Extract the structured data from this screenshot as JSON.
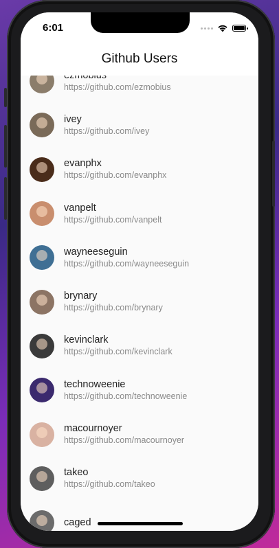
{
  "status_bar": {
    "time": "6:01"
  },
  "app_bar": {
    "title": "Github Users"
  },
  "users": [
    {
      "login": "ezmobius",
      "url": "https://github.com/ezmobius",
      "avatar_color": "#8b7d6b"
    },
    {
      "login": "ivey",
      "url": "https://github.com/ivey",
      "avatar_color": "#7a6a58"
    },
    {
      "login": "evanphx",
      "url": "https://github.com/evanphx",
      "avatar_color": "#4a2c1a"
    },
    {
      "login": "vanpelt",
      "url": "https://github.com/vanpelt",
      "avatar_color": "#c98e6e"
    },
    {
      "login": "wayneeseguin",
      "url": "https://github.com/wayneeseguin",
      "avatar_color": "#3f6f94"
    },
    {
      "login": "brynary",
      "url": "https://github.com/brynary",
      "avatar_color": "#8c7464"
    },
    {
      "login": "kevinclark",
      "url": "https://github.com/kevinclark",
      "avatar_color": "#3a3a3a"
    },
    {
      "login": "technoweenie",
      "url": "https://github.com/technoweenie",
      "avatar_color": "#3b2a6e"
    },
    {
      "login": "macournoyer",
      "url": "https://github.com/macournoyer",
      "avatar_color": "#d9b2a2"
    },
    {
      "login": "takeo",
      "url": "https://github.com/takeo",
      "avatar_color": "#5e5e5e"
    },
    {
      "login": "caged",
      "url": "",
      "avatar_color": "#6b6b6b"
    }
  ]
}
